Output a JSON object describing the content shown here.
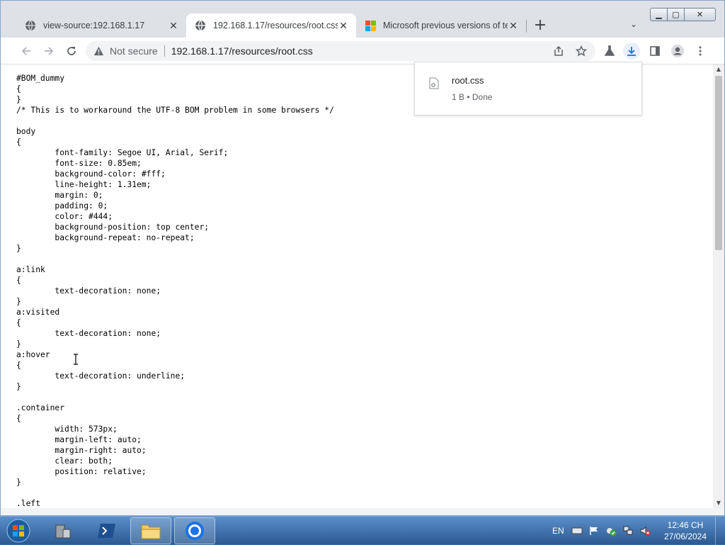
{
  "tabs": [
    {
      "label": "view-source:192.168.1.17",
      "icon": "globe-icon"
    },
    {
      "label": "192.168.1.17/resources/root.css",
      "icon": "globe-icon",
      "active": true
    },
    {
      "label": "Microsoft previous versions of te",
      "icon": "microsoft-logo-icon"
    }
  ],
  "tab_close_glyph": "✕",
  "new_tab_glyph": "+",
  "tab_search_glyph": "⌄",
  "window_controls": {
    "minimize": "▁",
    "maximize": "▢",
    "close": "✕"
  },
  "omnibox": {
    "security_label": "Not secure",
    "url": "192.168.1.17/resources/root.css"
  },
  "source_text": "#BOM_dummy\n{\n}\n/* This is to workaround the UTF-8 BOM problem in some browsers */\n\nbody\n{\n\tfont-family: Segoe UI, Arial, Serif;\n\tfont-size: 0.85em;\n\tbackground-color: #fff;\n\tline-height: 1.31em;\n\tmargin: 0;\n\tpadding: 0;\n\tcolor: #444;\n\tbackground-position: top center;\n\tbackground-repeat: no-repeat;\n}\n\na:link\n{\n\ttext-decoration: none;\n}\na:visited\n{\n\ttext-decoration: none;\n}\na:hover\n{\n\ttext-decoration: underline;\n}\n\n.container\n{\n\twidth: 573px;\n\tmargin-left: auto;\n\tmargin-right: auto;\n\tclear: both;\n\tposition: relative;\n}\n\n.left",
  "download": {
    "filename": "root.css",
    "status": "1 B • Done"
  },
  "scrollbar": {
    "up_arrow": "▲",
    "down_arrow": "▼"
  },
  "taskbar": {
    "language": "EN",
    "time": "12:46 CH",
    "date": "27/06/2024"
  },
  "colors": {
    "tabstrip": "#dee1e6",
    "active_tab": "#ffffff",
    "taskbar": "#2b5a91",
    "accent": "#1a73e8"
  }
}
